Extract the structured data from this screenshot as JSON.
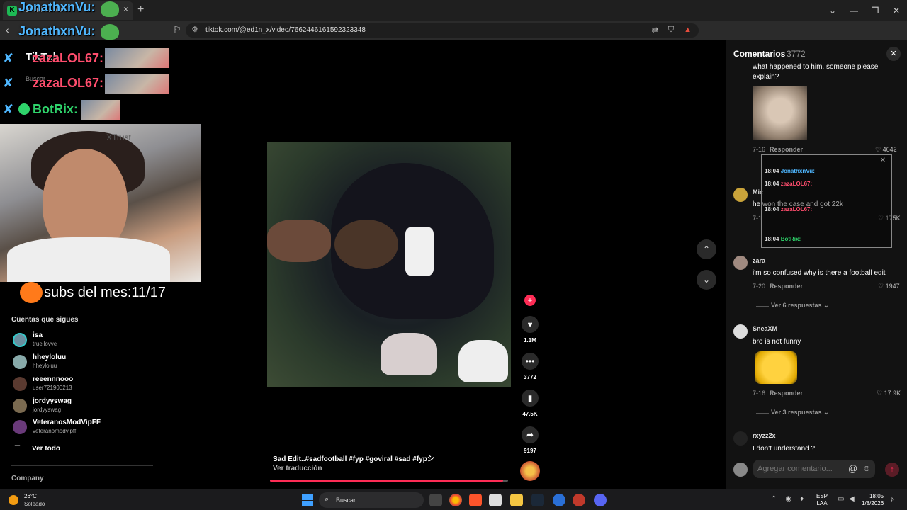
{
  "browser": {
    "tab_title": "JonathxnVu",
    "tab_close": "×",
    "new_tab": "+",
    "url": "tiktok.com/@ed1n_x/video/7662446161592323348",
    "window_controls": [
      "⌄",
      "—",
      "❐",
      "✕"
    ]
  },
  "overlay": {
    "streamer_name": "JonathxnVu:",
    "chat_names": [
      "zazaLOL67:",
      "zazaLOL67:",
      "BotRix:"
    ],
    "tiktok_logo": "TikTok",
    "search_ghost": "Buscar",
    "webcam_brand": "XTrust",
    "subs_text": "subs del mes:11/17"
  },
  "sidebar": {
    "following_title": "Cuentas que sigues",
    "accounts": [
      {
        "name": "isa",
        "handle": "truellovve"
      },
      {
        "name": "hheyloluu",
        "handle": "hheyloluu"
      },
      {
        "name": "reeennnooo",
        "handle": "user721900213"
      },
      {
        "name": "jordyyswag",
        "handle": "jordyyswag"
      },
      {
        "name": "VeteranosModVipFF",
        "handle": "veteranomodvipff"
      }
    ],
    "see_all": "Ver todo",
    "company": "Company"
  },
  "video": {
    "caption": "Sad Edit..#sadfootball #fyp #goviral #sad #fypシ",
    "translate": "Ver traducción",
    "progress": 0.98,
    "likes": "1.1M",
    "comments": "3772",
    "saves": "47.5K",
    "shares": "9197"
  },
  "comments": {
    "title": "Comentarios",
    "count": "3772",
    "close": "✕",
    "items": [
      {
        "user": "",
        "text": "what happened to him, someone please explain?",
        "date": "7-16",
        "reply": "Responder",
        "likes": "4642"
      },
      {
        "user": "Mic",
        "text": "he won the case and got 22k",
        "date": "7-1",
        "reply": "",
        "likes": "175K"
      },
      {
        "user": "zara",
        "text": "i'm so confused why is there a football edit",
        "date": "7-20",
        "reply": "Responder",
        "likes": "1947",
        "more": "Ver 6 respuestas"
      },
      {
        "user": "SneaXM",
        "text": "bro is not funny",
        "date": "7-16",
        "reply": "Responder",
        "likes": "17.9K",
        "more": "Ver 3 respuestas"
      },
      {
        "user": "rxyzz2x",
        "text": "I don't understand ?",
        "date": "",
        "reply": "",
        "likes": ""
      }
    ],
    "input_placeholder": "Agregar comentario..."
  },
  "chatbox": {
    "lines": [
      {
        "time": "18:04",
        "name": "JonathxnVu:"
      },
      {
        "time": "18:04",
        "name": "zazaLOL67:"
      },
      {
        "time": "18:04",
        "name": "zazaLOL67:"
      },
      {
        "time": "18:04",
        "name": "BotRix:"
      }
    ]
  },
  "taskbar": {
    "temp": "26°C",
    "weather": "Soleado",
    "search": "Buscar",
    "lang_top": "ESP",
    "lang_bottom": "LAA",
    "time": "18:05",
    "date": "1/8/2026"
  },
  "colors": {
    "accent": "#fe2c55",
    "background": "#000000",
    "panel": "#121212"
  }
}
